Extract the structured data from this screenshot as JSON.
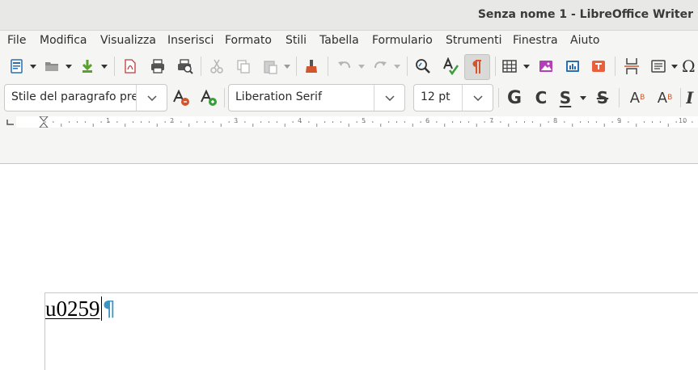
{
  "window": {
    "title": "Senza nome 1 - LibreOffice Writer"
  },
  "menu": [
    "File",
    "Modifica",
    "Visualizza",
    "Inserisci",
    "Formato",
    "Stili",
    "Tabella",
    "Formulario",
    "Strumenti",
    "Finestra",
    "Aiuto"
  ],
  "toolbar2": {
    "paragraph_style": "Stile del paragrafo pre",
    "font_name": "Liberation Serif",
    "font_size": "12 pt",
    "bold_glyph": "G",
    "italic_glyph": "C",
    "underline_glyph": "S",
    "strike_glyph": "S",
    "superscript_glyph": "A",
    "subscript_glyph": "A",
    "italic_style_glyph": "I"
  },
  "ruler": {
    "numbers": [
      "1",
      "2",
      "3",
      "4",
      "5",
      "6",
      "7",
      "8",
      "9",
      "10"
    ]
  },
  "document": {
    "text": "u0259",
    "pilcrow": "¶"
  },
  "colors": {
    "accent_pilcrow": "#3c95c4",
    "pressed_bg": "#d9d9d8"
  },
  "icons": [
    "new-document-icon",
    "open-folder-icon",
    "save-icon",
    "export-pdf-icon",
    "print-icon",
    "print-preview-icon",
    "cut-icon",
    "copy-icon",
    "paste-icon",
    "clone-formatting-icon",
    "undo-icon",
    "redo-icon",
    "find-replace-icon",
    "spellcheck-icon",
    "formatting-marks-icon",
    "table-icon",
    "image-icon",
    "chart-icon",
    "textbox-icon",
    "page-break-icon",
    "field-icon",
    "special-character-icon"
  ]
}
